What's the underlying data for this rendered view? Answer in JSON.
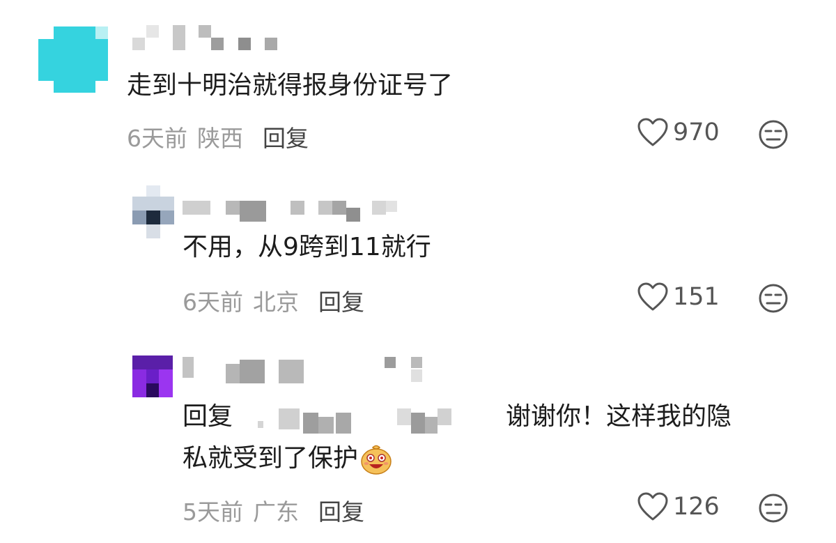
{
  "comments": [
    {
      "text": "走到十明治就得报身份证号了",
      "time": "6天前",
      "location": "陕西",
      "reply_label": "回复",
      "likes": "970"
    },
    {
      "text": "不用，从9跨到11就行",
      "time": "6天前",
      "location": "北京",
      "reply_label": "回复",
      "likes": "151"
    },
    {
      "reply_prefix": "回复",
      "text_line1": "谢谢你！这样我的隐",
      "text_line2": "私就受到了保护",
      "time": "5天前",
      "location": "广东",
      "reply_label": "回复",
      "likes": "126"
    }
  ],
  "icons": {
    "like": "heart-outline-icon",
    "dislike": "neutral-face-icon",
    "emoji": "laughing-face-emoji"
  },
  "colors": {
    "avatar1": "#35d3df",
    "avatar3": "#6a1fc8",
    "meta_text": "#9a9a9a",
    "body_text": "#1c1c1c"
  }
}
